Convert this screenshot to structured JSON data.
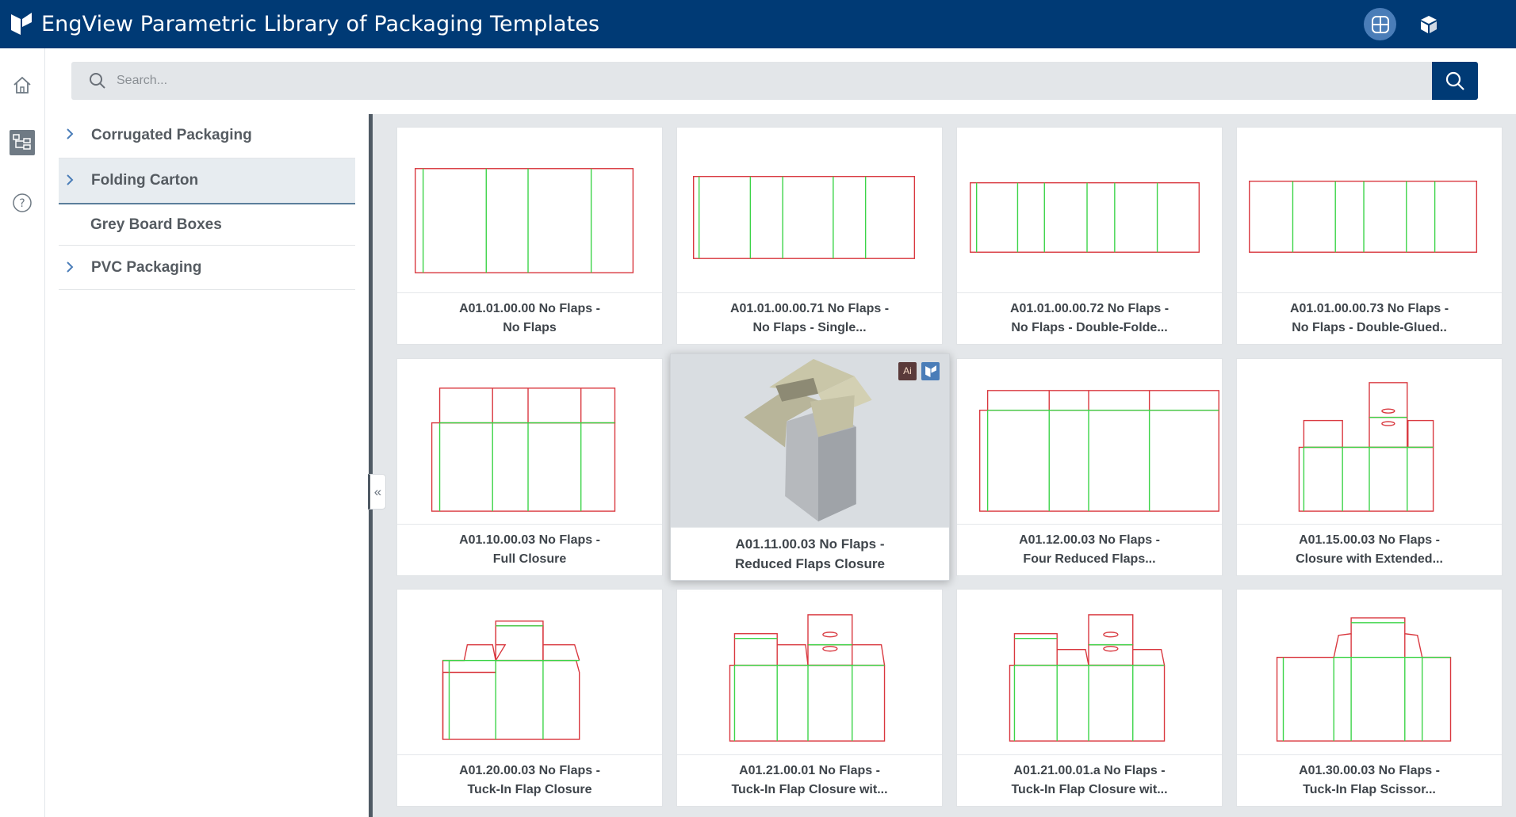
{
  "header": {
    "title": "EngView Parametric Library of Packaging Templates",
    "buttons": [
      {
        "name": "parametric-library-icon",
        "active": true
      },
      {
        "name": "3d-box-icon",
        "active": false
      }
    ]
  },
  "rail": {
    "icons": [
      "home-icon",
      "tree-view-icon",
      "help-icon"
    ],
    "active": "tree-view-icon"
  },
  "search": {
    "placeholder": "Search..."
  },
  "tree": {
    "items": [
      {
        "label": "Corrugated Packaging",
        "expandable": true,
        "selected": false
      },
      {
        "label": "Folding Carton",
        "expandable": true,
        "selected": true
      },
      {
        "label": "Grey Board Boxes",
        "expandable": false,
        "selected": false
      },
      {
        "label": "PVC Packaging",
        "expandable": true,
        "selected": false
      }
    ]
  },
  "collapse_label": "«",
  "cards": [
    {
      "line1": "A01.01.00.00 No Flaps -",
      "line2": "No Flaps"
    },
    {
      "line1": "A01.01.00.00.71 No Flaps -",
      "line2": "No Flaps - Single..."
    },
    {
      "line1": "A01.01.00.00.72 No Flaps -",
      "line2": "No Flaps - Double-Folde..."
    },
    {
      "line1": "A01.01.00.00.73 No Flaps -",
      "line2": "No Flaps - Double-Glued.."
    },
    {
      "line1": "A01.10.00.03 No Flaps -",
      "line2": "Full Closure"
    },
    {
      "line1": "A01.11.00.03 No Flaps -",
      "line2": "Reduced Flaps Closure",
      "hovered": true,
      "badges": [
        "Ai",
        "EV"
      ]
    },
    {
      "line1": "A01.12.00.03 No Flaps -",
      "line2": "Four Reduced Flaps..."
    },
    {
      "line1": "A01.15.00.03 No Flaps -",
      "line2": "Closure with Extended..."
    },
    {
      "line1": "A01.20.00.03 No Flaps -",
      "line2": "Tuck-In Flap Closure"
    },
    {
      "line1": "A01.21.00.01 No Flaps -",
      "line2": "Tuck-In Flap Closure wit..."
    },
    {
      "line1": "A01.21.00.01.a No Flaps -",
      "line2": "Tuck-In Flap Closure wit..."
    },
    {
      "line1": "A01.30.00.03 No Flaps -",
      "line2": "Tuck-In Flap Scissor..."
    }
  ],
  "badge_ai": "Ai",
  "colors": {
    "header": "#003a75",
    "cut_line": "#d9383f",
    "crease_line": "#3cd448",
    "grid_background": "#e4e7ea"
  }
}
